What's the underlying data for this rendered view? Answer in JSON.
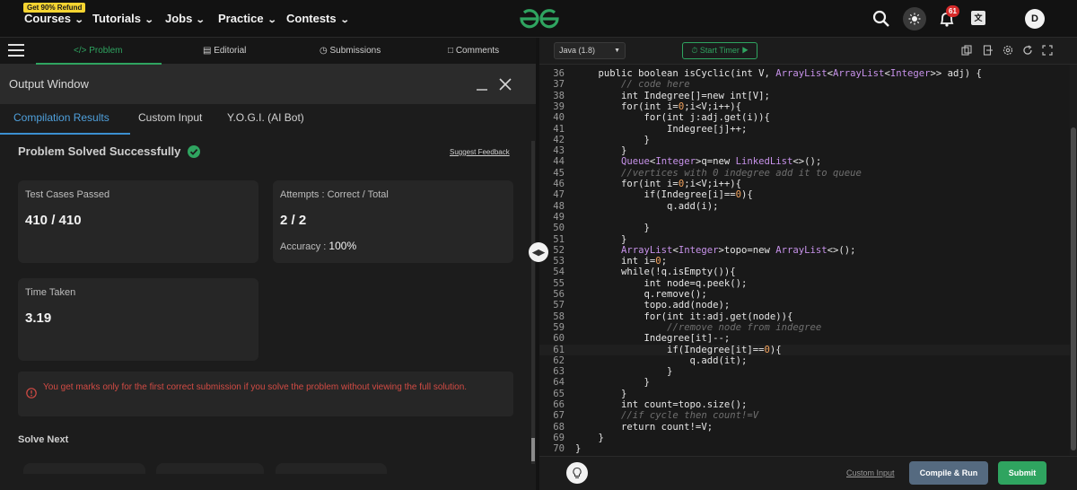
{
  "topnav": {
    "refund_badge": "Get 90% Refund",
    "items": [
      "Courses",
      "Tutorials",
      "Jobs",
      "Practice",
      "Contests"
    ],
    "notification_count": "61",
    "avatar_initial": "D"
  },
  "problem_tabs": {
    "problem": "Problem",
    "editorial": "Editorial",
    "submissions": "Submissions",
    "comments": "Comments"
  },
  "output_window": {
    "title": "Output Window",
    "tabs": [
      "Compilation Results",
      "Custom Input",
      "Y.O.G.I. (AI Bot)"
    ],
    "status": "Problem Solved Successfully",
    "suggest_feedback": "Suggest Feedback",
    "test_cases_label": "Test Cases Passed",
    "test_cases_value": "410 / 410",
    "attempts_label": "Attempts : Correct / Total",
    "attempts_value": "2 / 2",
    "accuracy_label": "Accuracy :",
    "accuracy_value": "100%",
    "time_label": "Time Taken",
    "time_value": "3.19",
    "warning": "You get marks only for the first correct submission if you solve the problem without viewing the full solution.",
    "solve_next": "Solve Next"
  },
  "editor": {
    "language": "Java (1.8)",
    "timer_label": "Start Timer",
    "custom_input": "Custom Input",
    "compile_run": "Compile & Run",
    "submit": "Submit",
    "lines": [
      {
        "n": "36",
        "t": "    public boolean isCyclic(int V, ArrayList<ArrayList<Integer>> adj) {"
      },
      {
        "n": "37",
        "t": "        // code here"
      },
      {
        "n": "38",
        "t": "        int Indegree[]=new int[V];"
      },
      {
        "n": "39",
        "t": "        for(int i=0;i<V;i++){"
      },
      {
        "n": "40",
        "t": "            for(int j:adj.get(i)){"
      },
      {
        "n": "41",
        "t": "                Indegree[j]++;"
      },
      {
        "n": "42",
        "t": "            }"
      },
      {
        "n": "43",
        "t": "        }"
      },
      {
        "n": "44",
        "t": "        Queue<Integer>q=new LinkedList<>();"
      },
      {
        "n": "45",
        "t": "        //vertices with 0 indegree add it to queue"
      },
      {
        "n": "46",
        "t": "        for(int i=0;i<V;i++){"
      },
      {
        "n": "47",
        "t": "            if(Indegree[i]==0){"
      },
      {
        "n": "48",
        "t": "                q.add(i);"
      },
      {
        "n": "49",
        "t": ""
      },
      {
        "n": "50",
        "t": "            }"
      },
      {
        "n": "51",
        "t": "        }"
      },
      {
        "n": "52",
        "t": "        ArrayList<Integer>topo=new ArrayList<>();"
      },
      {
        "n": "53",
        "t": "        int i=0;"
      },
      {
        "n": "54",
        "t": "        while(!q.isEmpty()){"
      },
      {
        "n": "55",
        "t": "            int node=q.peek();"
      },
      {
        "n": "56",
        "t": "            q.remove();"
      },
      {
        "n": "57",
        "t": "            topo.add(node);"
      },
      {
        "n": "58",
        "t": "            for(int it:adj.get(node)){"
      },
      {
        "n": "59",
        "t": "                //remove node from indegree"
      },
      {
        "n": "60",
        "t": "            Indegree[it]--;"
      },
      {
        "n": "61",
        "t": "                if(Indegree[it]==0){"
      },
      {
        "n": "62",
        "t": "                    q.add(it);"
      },
      {
        "n": "63",
        "t": "                }"
      },
      {
        "n": "64",
        "t": "            }"
      },
      {
        "n": "65",
        "t": "        }"
      },
      {
        "n": "66",
        "t": "        int count=topo.size();"
      },
      {
        "n": "67",
        "t": "        //if cycle then count!=V"
      },
      {
        "n": "68",
        "t": "        return count!=V;"
      },
      {
        "n": "69",
        "t": "    }"
      },
      {
        "n": "70",
        "t": "}"
      }
    ]
  },
  "colors": {
    "accent_green": "#2fa460",
    "tab_blue": "#4fa0dc",
    "warning_red": "#d24b44",
    "run_button": "#556a80"
  }
}
